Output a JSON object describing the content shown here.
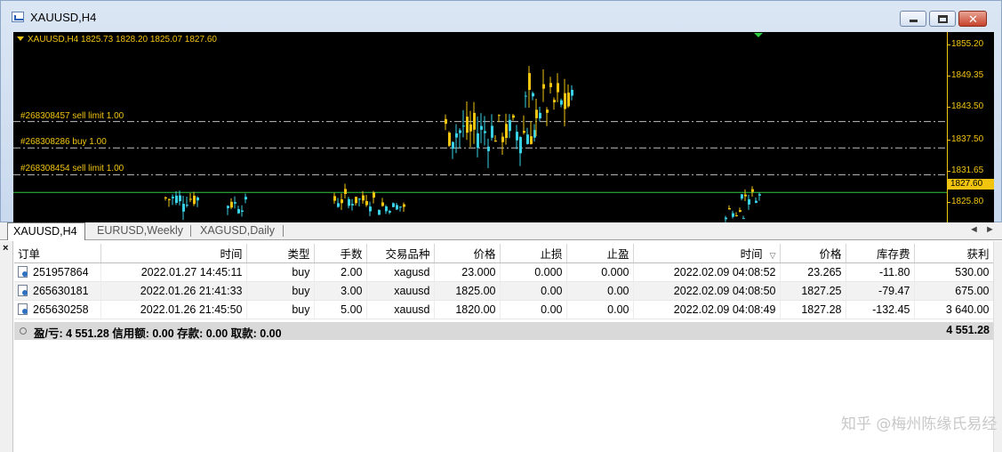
{
  "window": {
    "title": "XAUUSD,H4",
    "close_glyph": "✕"
  },
  "chart": {
    "header": "XAUUSD,H4  1825.73 1828.20 1825.07 1827.60",
    "current_price": "1827.60",
    "price_ticks": [
      "1855.20",
      "1849.35",
      "1843.50",
      "1837.50",
      "1831.65",
      "1825.80"
    ],
    "order_lines": [
      {
        "label": "#268308457 sell limit 1.00",
        "price": 1840.8
      },
      {
        "label": "#268308286 buy 1.00",
        "price": 1835.9
      },
      {
        "label": "#268308454 sell limit 1.00",
        "price": 1830.9
      }
    ],
    "colors": {
      "bg": "#000000",
      "up": "#f1c40f",
      "down": "#39d1e6",
      "bid": "#2ecc40",
      "grid": "#bfbfbf"
    }
  },
  "tabs": [
    {
      "label": "XAUUSD,H4",
      "active": true
    },
    {
      "label": "EURUSD,Weekly",
      "active": false
    },
    {
      "label": "XAGUSD,Daily",
      "active": false
    }
  ],
  "tab_nav": {
    "prev": "◄",
    "next": "►"
  },
  "panel": {
    "close_glyph": "×",
    "columns": [
      "订单",
      "时间",
      "类型",
      "手数",
      "交易品种",
      "价格",
      "止损",
      "止盈",
      "时间",
      "价格",
      "库存费",
      "获利"
    ],
    "sort_indicator": "▽",
    "rows": [
      [
        "251957864",
        "2022.01.27 14:45:11",
        "buy",
        "2.00",
        "xagusd",
        "23.000",
        "0.000",
        "0.000",
        "2022.02.09 04:08:52",
        "23.265",
        "-11.80",
        "530.00"
      ],
      [
        "265630181",
        "2022.01.26 21:41:33",
        "buy",
        "3.00",
        "xauusd",
        "1825.00",
        "0.00",
        "0.00",
        "2022.02.09 04:08:50",
        "1827.25",
        "-79.47",
        "675.00"
      ],
      [
        "265630258",
        "2022.01.26 21:45:50",
        "buy",
        "5.00",
        "xauusd",
        "1820.00",
        "0.00",
        "0.00",
        "2022.02.09 04:08:49",
        "1827.28",
        "-132.45",
        "3 640.00"
      ]
    ],
    "summary": "盈/亏: 4 551.28  信用额: 0.00  存款: 0.00  取款: 0.00",
    "summary_total": "4 551.28"
  },
  "watermark": "知乎 @梅州陈缘氏易经"
}
